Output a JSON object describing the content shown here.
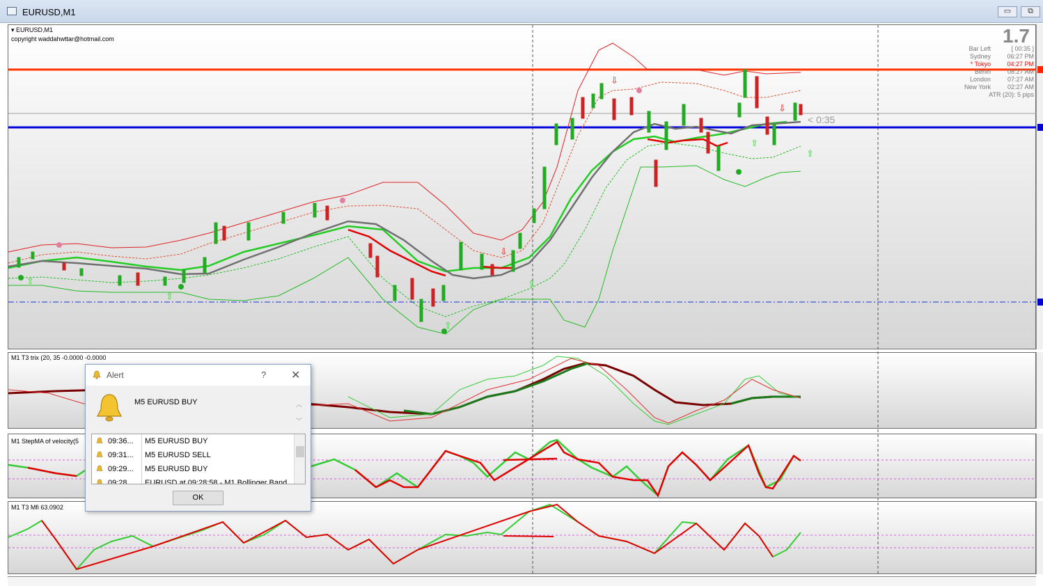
{
  "window": {
    "title": "EURUSD,M1",
    "minimize_label": "▭",
    "restore_label": "⧉"
  },
  "main_chart": {
    "symbol_label": "EURUSD,M1",
    "copyright": "copyright waddahwttar@hotmail.com",
    "countdown": "< 0:35",
    "big_value": "1.7",
    "sessions": [
      {
        "name": "Bar Left",
        "value": "[ 00:35 ]",
        "color": "#777777"
      },
      {
        "name": "Sydney",
        "value": "06:27 PM",
        "color": "#777777"
      },
      {
        "name": "* Tokyo",
        "value": "04:27 PM",
        "color": "#e01010"
      },
      {
        "name": "Berlin",
        "value": "08:27 AM",
        "color": "#777777"
      },
      {
        "name": "London",
        "value": "07:27 AM",
        "color": "#777777"
      },
      {
        "name": "New York",
        "value": "02:27 AM",
        "color": "#777777"
      }
    ],
    "atr": "ATR (20): 5 pips",
    "colors": {
      "resistance": "#ff3300",
      "support": "#0000dd",
      "bull_candle": "#22aa22",
      "bear_candle": "#cc2222",
      "upper_band": "#e02020",
      "lower_band": "#22bb22"
    }
  },
  "indicators": [
    {
      "label": "M1 T3 trix (20, 35 -0.0000 -0.0000"
    },
    {
      "label": "M1 StepMA of velocity(5"
    },
    {
      "label": "M1  T3 Mfi  63.0902"
    }
  ],
  "alert": {
    "title": "Alert",
    "help": "?",
    "close": "✕",
    "message": "M5 EURUSD  BUY",
    "rows": [
      {
        "time": "09:36...",
        "msg": "M5 EURUSD  BUY"
      },
      {
        "time": "09:31...",
        "msg": "M5 EURUSD  SELL"
      },
      {
        "time": "09:29...",
        "msg": "M5 EURUSD  BUY"
      },
      {
        "time": "09:28...",
        "msg": "EURUSD at 09:28:58 - M1 Bollinger Band"
      }
    ],
    "ok_label": "OK"
  }
}
